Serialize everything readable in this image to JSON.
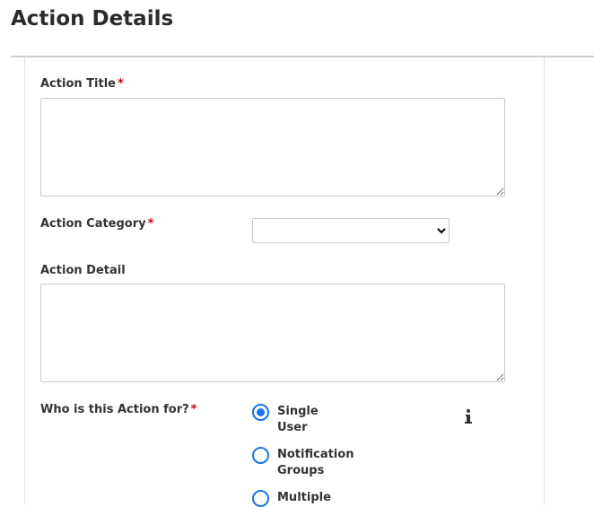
{
  "page_title": "Action Details",
  "fields": {
    "title_label": "Action Title",
    "title_required": "*",
    "category_label": "Action Category",
    "category_required": "*",
    "category_selected": "",
    "detail_label": "Action Detail",
    "target_label": "Who is this Action for?",
    "target_required": "*"
  },
  "target_options": [
    {
      "line1": "Single",
      "line2": "User",
      "checked": true
    },
    {
      "line1": "Notification",
      "line2": "Groups",
      "checked": false
    },
    {
      "line1": "Multiple",
      "line2": "",
      "checked": false
    }
  ],
  "icons": {
    "info": "info-icon"
  },
  "colors": {
    "accent": "#1a73e8",
    "required": "#d0021b"
  }
}
